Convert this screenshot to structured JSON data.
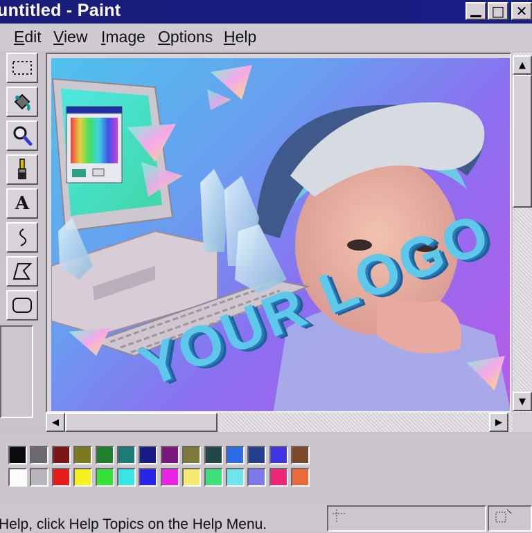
{
  "window": {
    "title": "untitled - Paint",
    "minimize_glyph": "▁",
    "maximize_glyph": "□",
    "close_glyph": "✕"
  },
  "menu": {
    "items": [
      {
        "label": "Edit",
        "key": "E",
        "rest": "dit"
      },
      {
        "label": "View",
        "key": "V",
        "rest": "iew"
      },
      {
        "label": "Image",
        "key": "I",
        "rest": "mage"
      },
      {
        "label": "Options",
        "key": "O",
        "rest": "ptions"
      },
      {
        "label": "Help",
        "key": "H",
        "rest": "elp"
      }
    ]
  },
  "tools": [
    {
      "name": "select-tool",
      "icon": "dashed-rectangle-icon"
    },
    {
      "name": "fill-tool",
      "icon": "paint-bucket-icon"
    },
    {
      "name": "magnifier-tool",
      "icon": "magnifier-icon"
    },
    {
      "name": "brush-tool",
      "icon": "brush-icon"
    },
    {
      "name": "text-tool",
      "icon": "text-a-icon",
      "glyph": "A"
    },
    {
      "name": "curve-tool",
      "icon": "curve-icon"
    },
    {
      "name": "polygon-tool",
      "icon": "polygon-icon"
    },
    {
      "name": "ellipse-tool",
      "icon": "rounded-rectangle-icon"
    }
  ],
  "canvas": {
    "logo_text": "YOUR LOGO",
    "colors": {
      "bg_start": "#4ec2ec",
      "bg_end": "#b65be8",
      "logo": "#5ec8ea"
    }
  },
  "palette": {
    "top_row": [
      "#0b0b0d",
      "#6d6a6f",
      "#7c1518",
      "#7b7a21",
      "#1f7f2c",
      "#1e7a76",
      "#191b87",
      "#7b177b",
      "#7d7a3b",
      "#234748",
      "#2b6ce8",
      "#243f8b",
      "#3c35e0",
      "#7c4a2a"
    ],
    "bottom_row": [
      "#fbfbfb",
      "#b9b6bb",
      "#e81b1b",
      "#f6f21f",
      "#36e239",
      "#37e6e4",
      "#2a24ea",
      "#ec22e6",
      "#f3ea6f",
      "#3ee07b",
      "#6fe4ec",
      "#7c7aec",
      "#ec2778",
      "#ec6a39"
    ]
  },
  "status": {
    "text": "Help, click Help Topics on the Help Menu."
  }
}
